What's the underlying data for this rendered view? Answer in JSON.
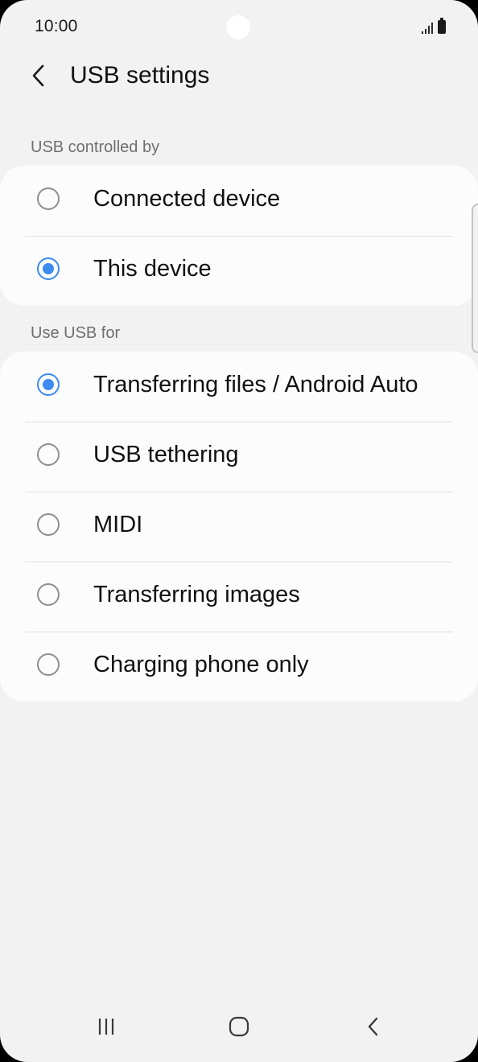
{
  "status_bar": {
    "time": "10:00",
    "icons": [
      "signal-icon",
      "battery-icon"
    ]
  },
  "header": {
    "back_icon": "chevron-left-icon",
    "title": "USB settings"
  },
  "sections": [
    {
      "title": "USB controlled by",
      "options": [
        {
          "label": "Connected device",
          "selected": false
        },
        {
          "label": "This device",
          "selected": true
        }
      ]
    },
    {
      "title": "Use USB for",
      "options": [
        {
          "label": "Transferring files / Android Auto",
          "selected": true
        },
        {
          "label": "USB tethering",
          "selected": false
        },
        {
          "label": "MIDI",
          "selected": false
        },
        {
          "label": "Transferring images",
          "selected": false
        },
        {
          "label": "Charging phone only",
          "selected": false
        }
      ]
    }
  ],
  "nav_bar": {
    "icons": [
      "recent-apps-icon",
      "home-icon",
      "back-icon"
    ]
  },
  "colors": {
    "accent": "#3e8bf0",
    "background": "#f2f2f2",
    "card": "#fcfcfc",
    "section_header": "#6f6f6f"
  }
}
